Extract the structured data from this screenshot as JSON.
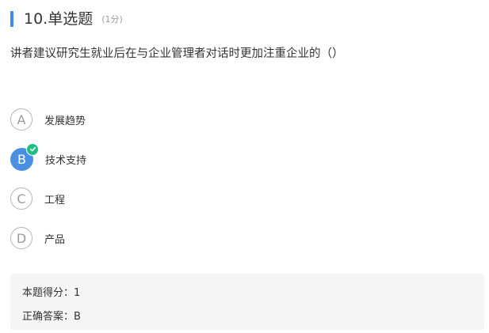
{
  "question": {
    "number_title": "10.单选题",
    "score": "(1分)",
    "stem": "讲者建议研究生就业后在与企业管理者对话时更加注重企业的（）"
  },
  "options": [
    {
      "letter": "A",
      "text": "发展趋势",
      "selected": false
    },
    {
      "letter": "B",
      "text": "技术支持",
      "selected": true
    },
    {
      "letter": "C",
      "text": "工程",
      "selected": false
    },
    {
      "letter": "D",
      "text": "产品",
      "selected": false
    }
  ],
  "result": {
    "score_label": "本题得分：",
    "score_value": "1",
    "answer_label": "正确答案：",
    "answer_value": "B"
  },
  "colors": {
    "accent": "#3a8ee6",
    "selected": "#4a90e2",
    "check": "#1fbf7f",
    "result_bg": "#f5f5f5"
  },
  "icons": {
    "selected_check": "check-icon"
  }
}
